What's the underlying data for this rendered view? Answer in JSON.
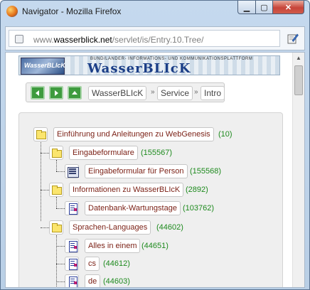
{
  "window": {
    "title": "Navigator - Mozilla Firefox",
    "minimize_glyph": "▁",
    "maximize_glyph": "▢",
    "close_glyph": "✕"
  },
  "address_bar": {
    "prefix": "www.",
    "domain": "wasserblick.net",
    "path": "/servlet/is/Entry.10.Tree/"
  },
  "banner": {
    "subtitle": "BUND/LÄNDER- INFORMATIONS- UND KOMMUNIKATIONSPLATTFORM",
    "title": "WasserBLIcK",
    "logo_text": "WasserBLIcK"
  },
  "nav": {
    "back_icon": "left-arrow-icon",
    "forward_icon": "right-arrow-icon",
    "up_icon": "up-arrow-icon",
    "breadcrumbs": [
      "WasserBLIcK",
      "Service",
      "Intro"
    ],
    "separator": "»"
  },
  "tree": {
    "nodes": [
      {
        "label": "Einführung und Anleitungen zu WebGenesis",
        "count": "(10)",
        "icon": "folder-icon"
      },
      {
        "label": "Eingabeformulare",
        "count": "(155567)",
        "icon": "folder-icon"
      },
      {
        "label": "Eingabeformular für Person",
        "count": "(155568)",
        "icon": "form-icon"
      },
      {
        "label": "Informationen zu WasserBLIcK",
        "count": "(2892)",
        "icon": "folder-icon"
      },
      {
        "label": "Datenbank-Wartungstage",
        "count": "(103762)",
        "icon": "document-icon"
      },
      {
        "label": "Sprachen-Languages",
        "count": "(44602)",
        "icon": "folder-icon"
      },
      {
        "label": "Alles in einem",
        "count": "(44651)",
        "icon": "document-icon"
      },
      {
        "label": "cs",
        "count": "(44612)",
        "icon": "document-icon"
      },
      {
        "label": "de",
        "count": "(44603)",
        "icon": "document-icon"
      }
    ]
  },
  "colors": {
    "label_text": "#7a1f14",
    "count_text": "#1d8a1d",
    "nav_button": "#3e9b3e",
    "folder": "#fbe56d"
  }
}
